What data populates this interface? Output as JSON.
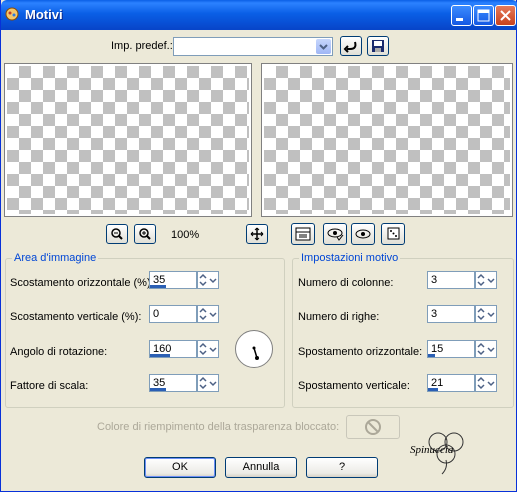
{
  "window": {
    "title": "Motivi"
  },
  "toolbar": {
    "preset_label": "Imp. predef.:",
    "preset_value": ""
  },
  "zoom": {
    "level": "100%"
  },
  "area_group": {
    "title": "Area d'immagine",
    "fields": [
      {
        "label": "Scostamento orizzontale (%):",
        "value": "35",
        "fill": 0.35
      },
      {
        "label": "Scostamento verticale (%):",
        "value": "0",
        "fill": 0.0
      },
      {
        "label": "Angolo di rotazione:",
        "value": "160",
        "fill": 0.44
      },
      {
        "label": "Fattore di scala:",
        "value": "35",
        "fill": 0.35
      }
    ]
  },
  "pattern_group": {
    "title": "Impostazioni motivo",
    "fields": [
      {
        "label": "Numero di colonne:",
        "value": "3"
      },
      {
        "label": "Numero di righe:",
        "value": "3"
      },
      {
        "label": "Spostamento orizzontale:",
        "value": "15",
        "fill": 0.15
      },
      {
        "label": "Spostamento verticale:",
        "value": "21",
        "fill": 0.21
      }
    ]
  },
  "transparency": {
    "label": "Colore di riempimento della trasparenza bloccato:"
  },
  "buttons": {
    "ok": "OK",
    "cancel": "Annulla",
    "help": "?"
  },
  "watermark": {
    "text": "Spinuccia"
  },
  "colors": {
    "title_bar": "#0a5fe6",
    "accent": "#0046d5",
    "bar": "#2b5fb4"
  }
}
